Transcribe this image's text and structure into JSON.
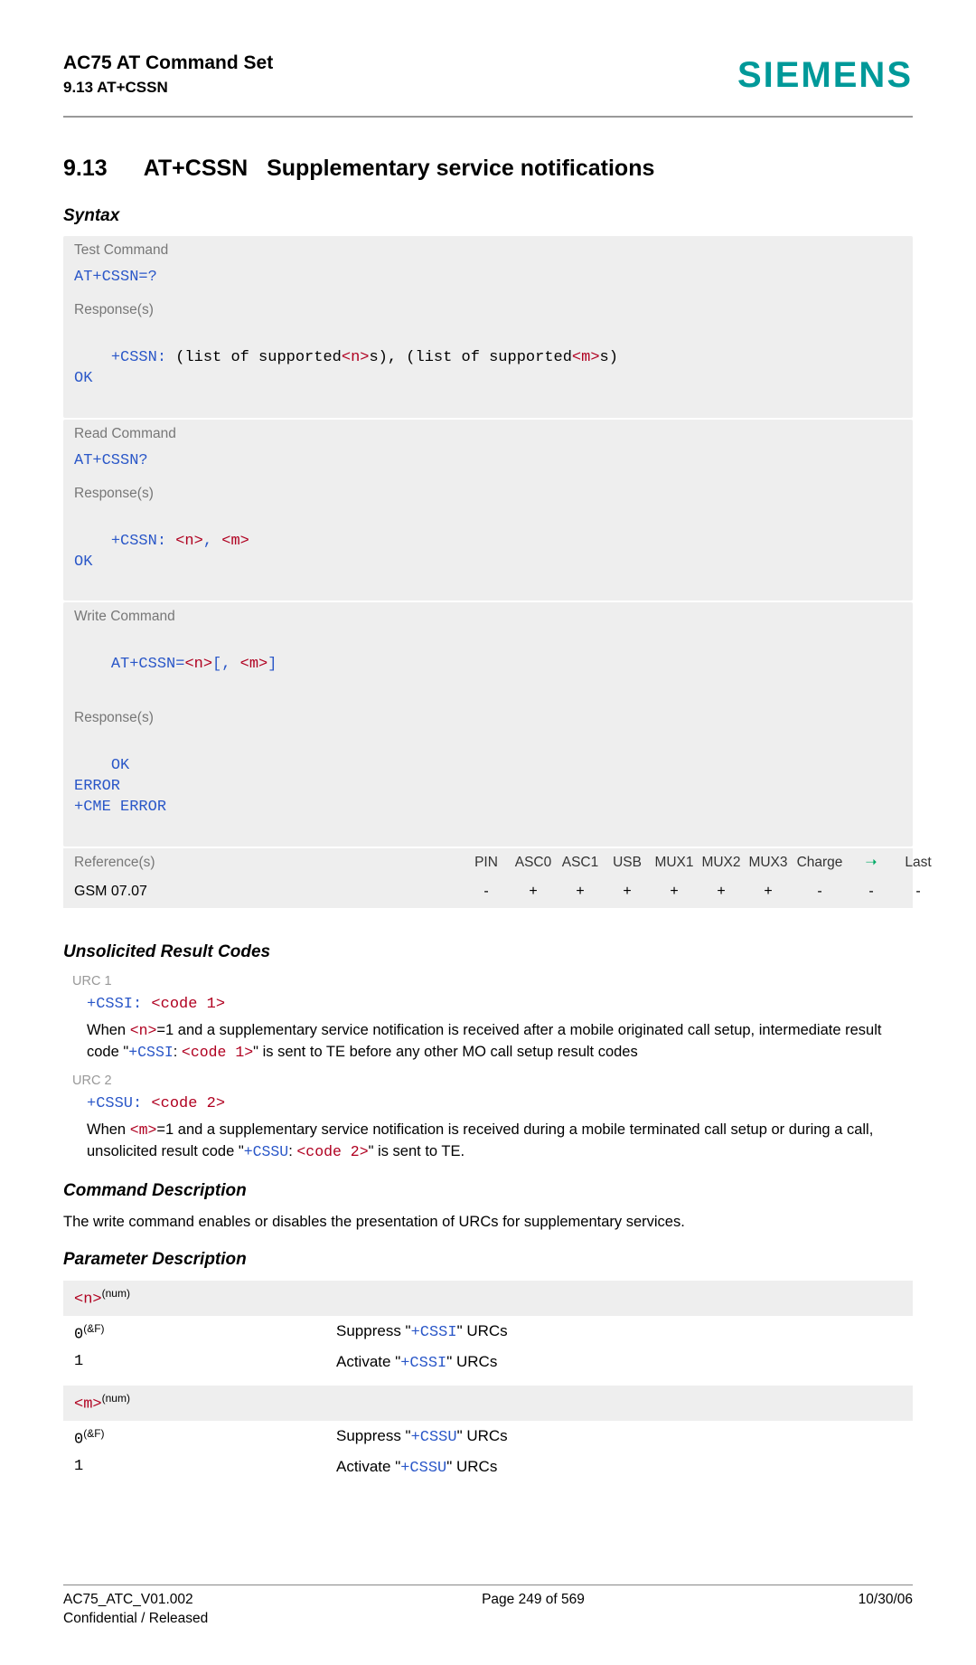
{
  "header": {
    "title": "AC75 AT Command Set",
    "sub": "9.13 AT+CSSN",
    "brand": "SIEMENS"
  },
  "section": {
    "number": "9.13",
    "cmd": "AT+CSSN",
    "title": "Supplementary service notifications"
  },
  "syntax_header": "Syntax",
  "boxes": {
    "test_label": "Test Command",
    "test_cmd": "AT+CSSN=?",
    "response_label": "Response(s)",
    "test_resp_pre": "+CSSN: ",
    "test_resp_1": "(list of supported",
    "test_resp_n": "<n>",
    "test_resp_mid": "s), (list of supported",
    "test_resp_m": "<m>",
    "test_resp_end": "s)",
    "ok": "OK",
    "read_label": "Read Command",
    "read_cmd": "AT+CSSN?",
    "read_resp_pre": "+CSSN: ",
    "read_n": "<n>",
    "read_comma": ", ",
    "read_m": "<m>",
    "write_label": "Write Command",
    "write_cmd_pre": "AT+CSSN=",
    "write_n": "<n>",
    "write_mid": "[, ",
    "write_m": "<m>",
    "write_end": "]",
    "write_ok": "OK",
    "write_error": "ERROR",
    "write_cme": "+CME ERROR"
  },
  "refrow": {
    "label": "Reference(s)",
    "cols": [
      "PIN",
      "ASC0",
      "ASC1",
      "USB",
      "MUX1",
      "MUX2",
      "MUX3",
      "Charge",
      "➝",
      "Last"
    ],
    "name": "GSM 07.07",
    "vals": [
      "-",
      "+",
      "+",
      "+",
      "+",
      "+",
      "+",
      "-",
      "-",
      "-"
    ]
  },
  "urc": {
    "header": "Unsolicited Result Codes",
    "urc1_label": "URC 1",
    "urc1_code_pre": "+CSSI: ",
    "urc1_code_param": "<code 1>",
    "urc1_text_1": "When ",
    "urc1_text_n": "<n>",
    "urc1_text_2": "=1 and a supplementary service notification is received after a mobile originated call setup, intermediate result code \"",
    "urc1_text_cssi": "+CSSI",
    "urc1_text_colon": ": ",
    "urc1_text_code": "<code 1>",
    "urc1_text_3": "\" is sent to TE before any other MO call setup result codes",
    "urc2_label": "URC 2",
    "urc2_code_pre": "+CSSU: ",
    "urc2_code_param": "<code 2>",
    "urc2_text_1": "When ",
    "urc2_text_m": "<m>",
    "urc2_text_2": "=1 and a supplementary service notification is received during a mobile terminated call setup or during a call, unsolicited result code \"",
    "urc2_text_cssu": "+CSSU",
    "urc2_text_colon": ": ",
    "urc2_text_code": "<code 2>",
    "urc2_text_3": "\" is sent to TE."
  },
  "cmddesc": {
    "header": "Command Description",
    "text": "The write command enables or disables the presentation of URCs for supplementary services."
  },
  "paramdesc": {
    "header": "Parameter Description",
    "n_label": "<n>",
    "n_sup": "(num)",
    "zero": "0",
    "zero_sup": "(&F)",
    "one": "1",
    "n_suppress_pre": "Suppress \"",
    "n_cssi": "+CSSI",
    "n_suppress_post": "\" URCs",
    "n_activate_pre": "Activate \"",
    "n_activate_post": "\" URCs",
    "m_label": "<m>",
    "m_sup": "(num)",
    "m_cssu": "+CSSU"
  },
  "footer": {
    "left1": "AC75_ATC_V01.002",
    "left2": "Confidential / Released",
    "center": "Page 249 of 569",
    "right": "10/30/06"
  }
}
